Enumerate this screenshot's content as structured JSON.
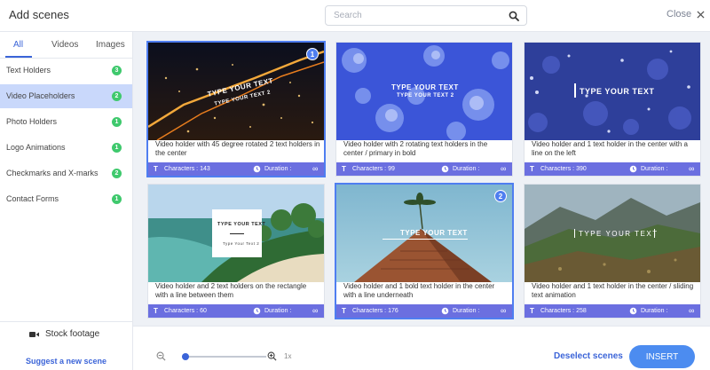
{
  "header": {
    "title": "Add scenes",
    "search_placeholder": "Search",
    "search_value": "",
    "close_label": "Close"
  },
  "sidebar": {
    "tabs": [
      {
        "label": "All",
        "active": true
      },
      {
        "label": "Videos",
        "active": false
      },
      {
        "label": "Images",
        "active": false
      }
    ],
    "categories": [
      {
        "label": "Text Holders",
        "count": "3",
        "active": false
      },
      {
        "label": "Video Placeholders",
        "count": "2",
        "active": true
      },
      {
        "label": "Photo Holders",
        "count": "1",
        "active": false
      },
      {
        "label": "Logo Animations",
        "count": "1",
        "active": false
      },
      {
        "label": "Checkmarks and X-marks",
        "count": "2",
        "active": false
      },
      {
        "label": "Contact Forms",
        "count": "1",
        "active": false
      }
    ],
    "stock_label": "Stock footage",
    "suggest_label": "Suggest a new scene"
  },
  "cards": [
    {
      "description": "Video holder with 45 degree rotated 2 text holders in the center",
      "thumb_text_1": "TYPE YOUR TEXT",
      "thumb_text_2": "TYPE YOUR TEXT 2",
      "characters_label": "Characters : 143",
      "duration_label": "Duration :",
      "duration_value": "∞",
      "selected": true,
      "selection_number": "1"
    },
    {
      "description": "Video holder with 2 rotating text holders in the center / primary in bold",
      "thumb_text_1": "TYPE YOUR TEXT",
      "thumb_text_2": "TYPE YOUR TEXT 2",
      "characters_label": "Characters : 99",
      "duration_label": "Duration :",
      "duration_value": "∞",
      "selected": false,
      "selection_number": ""
    },
    {
      "description": "Video holder and 1 text holder in the center with a line on the left",
      "thumb_text_1": "TYPE YOUR TEXT",
      "thumb_text_2": "",
      "characters_label": "Characters : 390",
      "duration_label": "Duration :",
      "duration_value": "∞",
      "selected": false,
      "selection_number": ""
    },
    {
      "description": "Video holder and 2 text holders on the rectangle with a line between them",
      "thumb_text_1": "TYPE YOUR TEXT",
      "thumb_text_2": "Type Your Text 2",
      "characters_label": "Characters : 60",
      "duration_label": "Duration :",
      "duration_value": "∞",
      "selected": false,
      "selection_number": ""
    },
    {
      "description": "Video holder and 1 bold text holder in the center with a line underneath",
      "thumb_text_1": "TYPE YOUR TEXT",
      "thumb_text_2": "",
      "characters_label": "Characters : 176",
      "duration_label": "Duration :",
      "duration_value": "∞",
      "selected": true,
      "selection_number": "2"
    },
    {
      "description": "Video holder and 1 text holder in the center / sliding text animation",
      "thumb_text_1": "TYPE YOUR TEXT",
      "thumb_text_2": "",
      "characters_label": "Characters : 258",
      "duration_label": "Duration :",
      "duration_value": "∞",
      "selected": false,
      "selection_number": ""
    }
  ],
  "bottom": {
    "zoom_level": "1x",
    "zoom_fraction": 0.0,
    "deselect_label": "Deselect scenes",
    "insert_label": "INSERT"
  },
  "colors": {
    "accent": "#3b64d8",
    "badge_green": "#3fc96d",
    "card_footer": "#6b6fe0",
    "insert_button": "#4c8cf0",
    "active_category": "#c9d8fb"
  }
}
